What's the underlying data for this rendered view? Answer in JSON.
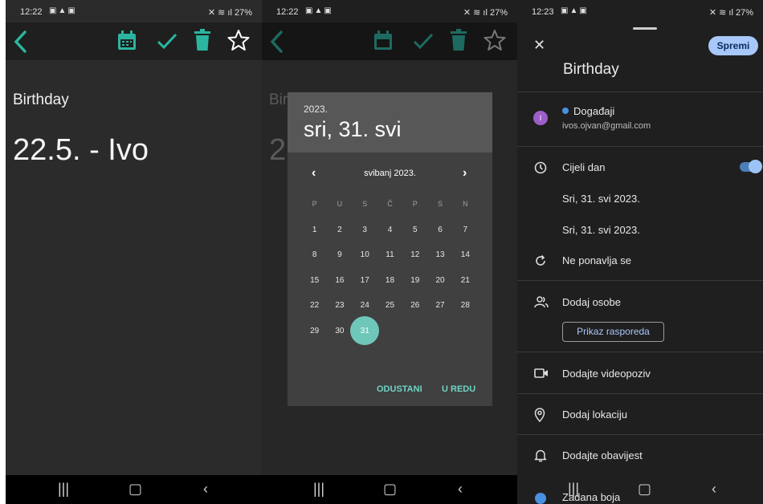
{
  "screen1": {
    "status": {
      "time": "12:22",
      "battery": "27%"
    },
    "note_title": "Birthday",
    "note_body": "22.5. - Ivo"
  },
  "screen2": {
    "status": {
      "time": "12:22",
      "battery": "27%"
    },
    "dim_title": "Bir",
    "dim_body": "2",
    "dialog": {
      "year": "2023.",
      "selected_date": "sri, 31. svi",
      "month_label": "svibanj 2023.",
      "weekdays": [
        "P",
        "U",
        "S",
        "Č",
        "P",
        "S",
        "N"
      ],
      "weeks": [
        [
          "1",
          "2",
          "3",
          "4",
          "5",
          "6",
          "7"
        ],
        [
          "8",
          "9",
          "10",
          "11",
          "12",
          "13",
          "14"
        ],
        [
          "15",
          "16",
          "17",
          "18",
          "19",
          "20",
          "21"
        ],
        [
          "22",
          "23",
          "24",
          "25",
          "26",
          "27",
          "28"
        ],
        [
          "29",
          "30",
          "31",
          "",
          "",
          "",
          ""
        ]
      ],
      "selected_day": "31",
      "cancel_label": "ODUSTANI",
      "ok_label": "U REDU"
    }
  },
  "screen3": {
    "status": {
      "time": "12:23",
      "battery": "27%"
    },
    "save_label": "Spremi",
    "event_title": "Birthday",
    "avatar_initial": "I",
    "calendar_name": "Događaji",
    "calendar_account": "ivos.ojvan@gmail.com",
    "all_day_label": "Cijeli dan",
    "start_date": "Sri, 31. svi 2023.",
    "end_date": "Sri, 31. svi 2023.",
    "repeat_label": "Ne ponavlja se",
    "add_people_label": "Dodaj osobe",
    "schedule_button_label": "Prikaz rasporeda",
    "video_label": "Dodajte videopoziv",
    "location_label": "Dodaj lokaciju",
    "notification_label": "Dodajte obavijest",
    "color_label": "Zadana boja"
  },
  "colors": {
    "accent_teal": "#2bb5a0",
    "selected_day": "#6fc7ba",
    "save_button": "#a8c7fa",
    "calendar_dot": "#4a90e2",
    "avatar": "#9c5fc9"
  }
}
